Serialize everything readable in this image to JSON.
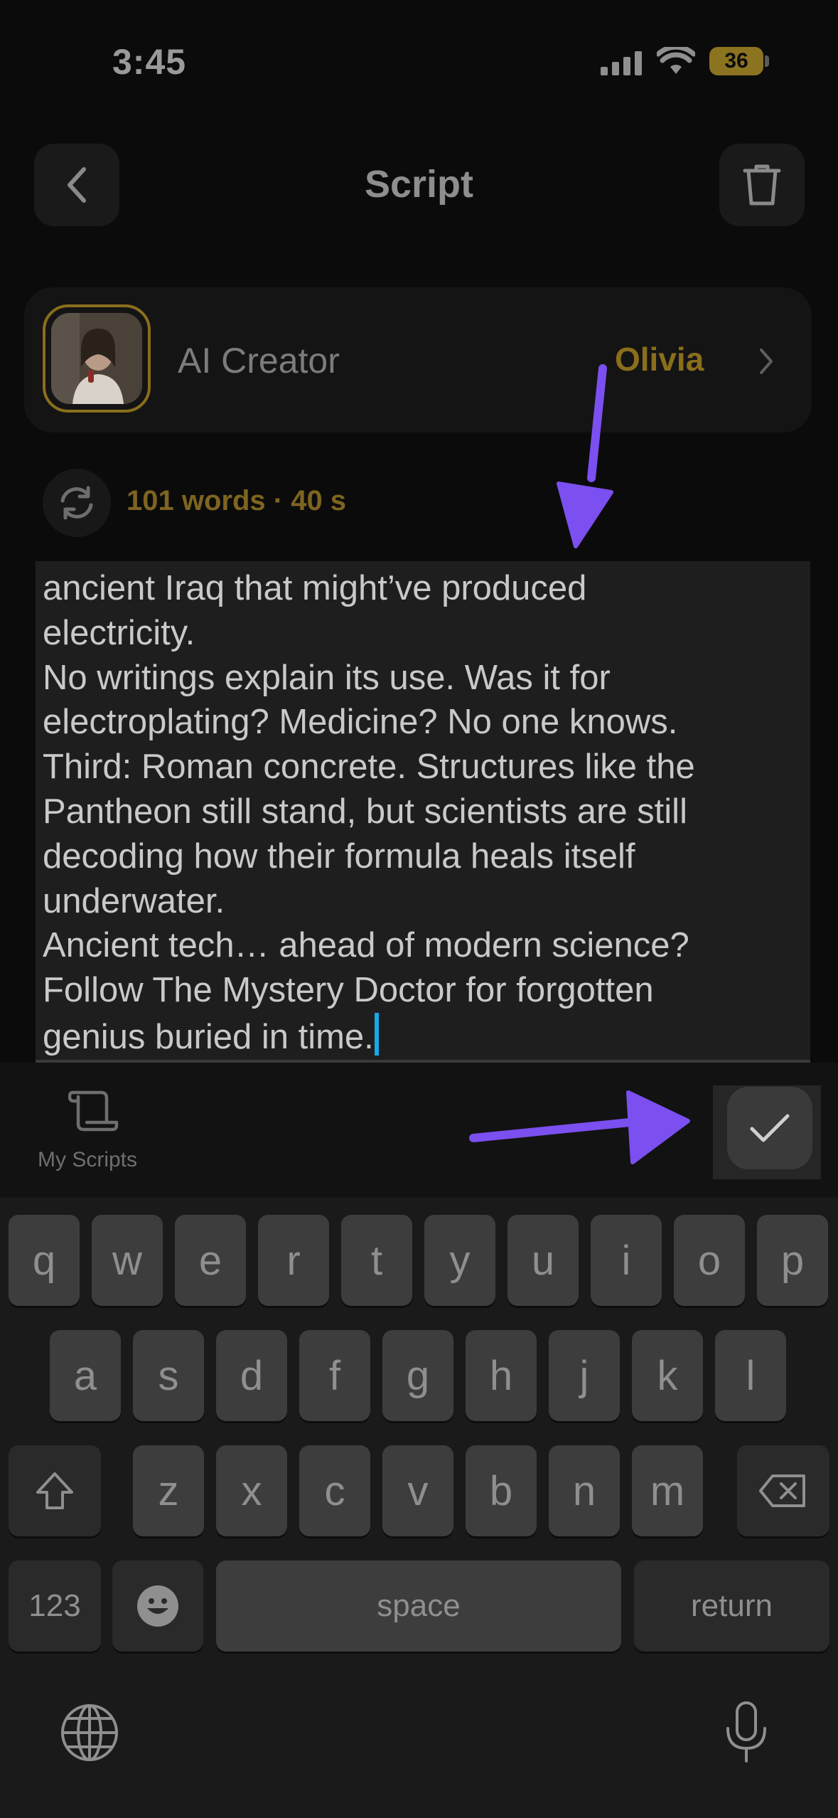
{
  "status_bar": {
    "time": "3:45",
    "battery": "36"
  },
  "header": {
    "title": "Script"
  },
  "creator": {
    "label": "AI Creator",
    "name": "Olivia"
  },
  "script_stats": "101 words · 40 s",
  "editor": {
    "lines": [
      "ancient Iraq that might’ve produced",
      "electricity.",
      "No writings explain its use. Was it for",
      "electroplating? Medicine? No one knows.",
      "Third: Roman concrete. Structures like the",
      "Pantheon still stand, but scientists are still",
      "decoding how their formula heals itself",
      "underwater.",
      "Ancient tech… ahead of modern science?",
      "Follow The Mystery Doctor for forgotten",
      "genius buried in time."
    ]
  },
  "toolbar": {
    "my_scripts_label": "My Scripts"
  },
  "keyboard": {
    "row1": [
      "q",
      "w",
      "e",
      "r",
      "t",
      "y",
      "u",
      "i",
      "o",
      "p"
    ],
    "row2": [
      "a",
      "s",
      "d",
      "f",
      "g",
      "h",
      "j",
      "k",
      "l"
    ],
    "row3": [
      "z",
      "x",
      "c",
      "v",
      "b",
      "n",
      "m"
    ],
    "numbers_key": "123",
    "space_key": "space",
    "return_key": "return"
  },
  "icons": {
    "back": "chevron-left-icon",
    "delete": "trash-icon",
    "refresh": "refresh-icon",
    "my_scripts": "scroll-icon",
    "confirm": "checkmark-icon",
    "shift": "shift-icon",
    "backspace": "backspace-icon",
    "emoji": "emoji-icon",
    "globe": "globe-icon",
    "mic": "microphone-icon"
  },
  "colors": {
    "accent_gold": "#8a6e1c",
    "arrow_annotation": "#7b4ff0",
    "cursor": "#17a9e8"
  }
}
